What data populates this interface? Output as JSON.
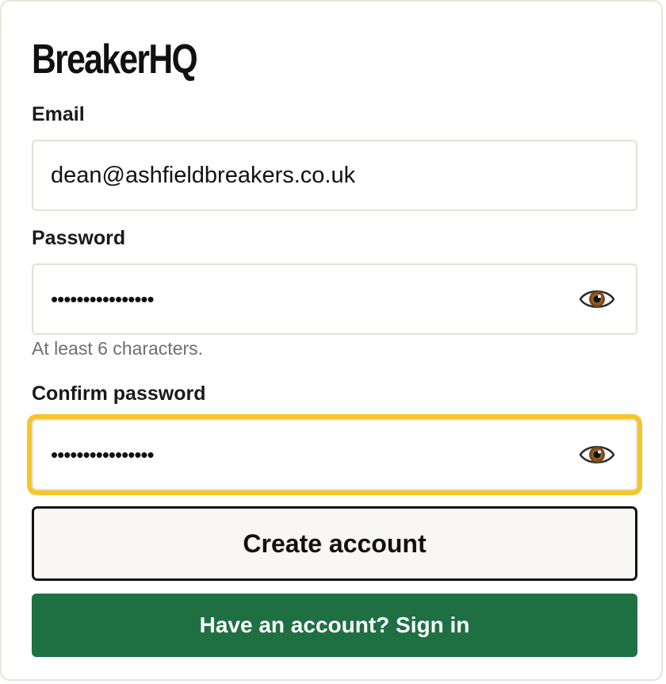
{
  "brand": {
    "name": "BreakerHQ"
  },
  "form": {
    "email": {
      "label": "Email",
      "value": "dean@ashfieldbreakers.co.uk"
    },
    "password": {
      "label": "Password",
      "value": "••••••••••••••••",
      "hint": "At least 6 characters.",
      "toggle_icon": "eye-icon"
    },
    "confirm_password": {
      "label": "Confirm password",
      "value": "••••••••••••••••",
      "toggle_icon": "eye-icon",
      "focused": true
    },
    "create_button": "Create account",
    "signin_button": "Have an account? Sign in"
  },
  "colors": {
    "primary_green": "#1e7043",
    "focus_ring": "#f6c528",
    "border": "#e3e1d8",
    "text": "#1a1a1a",
    "hint_text": "#6f6f6f",
    "secondary_button_bg": "#f8f7f3"
  }
}
